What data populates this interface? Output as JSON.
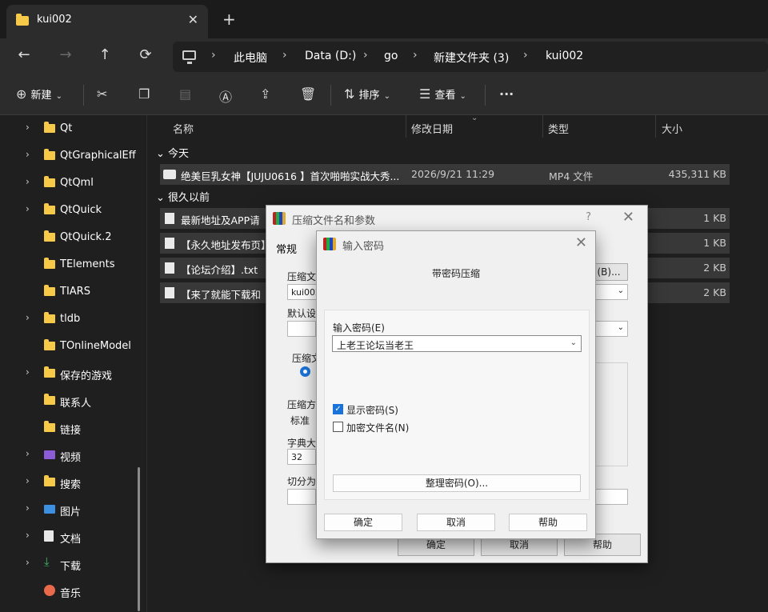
{
  "tab": {
    "title": "kui002",
    "close": "✕",
    "new": "+"
  },
  "nav": {
    "back": "←",
    "forward": "→",
    "up": "↑",
    "refresh": "⟳",
    "sep": "›"
  },
  "breadcrumb": [
    "此电脑",
    "Data (D:)",
    "go",
    "新建文件夹 (3)",
    "kui002"
  ],
  "toolbar": {
    "new_label": "新建",
    "sort_label": "排序",
    "view_label": "查看",
    "more": "···",
    "icons": [
      "cut-icon",
      "copy-icon",
      "paste-icon",
      "rename-icon",
      "share-icon",
      "delete-icon"
    ]
  },
  "sidebar": {
    "items": [
      {
        "label": "Qt",
        "chev": "›",
        "icon": "folder"
      },
      {
        "label": "QtGraphicalEff",
        "chev": "›",
        "icon": "folder"
      },
      {
        "label": "QtQml",
        "chev": "›",
        "icon": "folder"
      },
      {
        "label": "QtQuick",
        "chev": "›",
        "icon": "folder"
      },
      {
        "label": "QtQuick.2",
        "chev": "",
        "icon": "folder"
      },
      {
        "label": "TElements",
        "chev": "",
        "icon": "folder"
      },
      {
        "label": "TIARS",
        "chev": "",
        "icon": "folder"
      },
      {
        "label": "tldb",
        "chev": "›",
        "icon": "folder"
      },
      {
        "label": "TOnlineModel",
        "chev": "",
        "icon": "folder"
      },
      {
        "label": "保存的游戏",
        "chev": "›",
        "icon": "folder"
      },
      {
        "label": "联系人",
        "chev": "",
        "icon": "folder"
      },
      {
        "label": "链接",
        "chev": "",
        "icon": "folder"
      },
      {
        "label": "视频",
        "chev": "›",
        "icon": "video"
      },
      {
        "label": "搜索",
        "chev": "›",
        "icon": "folder"
      },
      {
        "label": "图片",
        "chev": "›",
        "icon": "pic"
      },
      {
        "label": "文档",
        "chev": "›",
        "icon": "doc"
      },
      {
        "label": "下载",
        "chev": "›",
        "icon": "down"
      },
      {
        "label": "音乐",
        "chev": "",
        "icon": "music"
      }
    ]
  },
  "columns": {
    "name": "名称",
    "modified": "修改日期",
    "type": "类型",
    "size": "大小"
  },
  "groups": {
    "today": "今天",
    "long_ago": "很久以前"
  },
  "files_today": [
    {
      "name": "绝美巨乳女神【JUJU0616 】首次啪啪实战大秀...",
      "modified": "2026/9/21 11:29",
      "type": "MP4 文件",
      "size": "435,311 KB"
    }
  ],
  "files_old": [
    {
      "name": "最新地址及APP请",
      "size": "1 KB"
    },
    {
      "name": "【永久地址发布页】",
      "size": "1 KB"
    },
    {
      "name": "【论坛介绍】.txt",
      "size": "2 KB"
    },
    {
      "name": "【来了就能下载和",
      "size": "2 KB"
    }
  ],
  "dialog1": {
    "title": "压缩文件名和参数",
    "help_q": "?",
    "close": "✕",
    "tab_general": "常规",
    "archive_label": "压缩文",
    "archive_value": "kui002",
    "browse": "(B)...",
    "default_label": "默认设",
    "format_label": "压缩文",
    "method_label": "压缩方式",
    "method_value": "标准",
    "dict_label": "字典大小",
    "dict_value": "32",
    "split_label": "切分为分",
    "ok": "确定",
    "cancel": "取消",
    "help": "帮助"
  },
  "dialog2": {
    "title": "输入密码",
    "close": "✕",
    "subtitle": "带密码压缩",
    "pwd_label": "输入密码(E)",
    "pwd_value": "上老王论坛当老王",
    "show_pwd": "显示密码(S)",
    "show_pwd_checked": true,
    "encrypt_names": "加密文件名(N)",
    "encrypt_names_checked": false,
    "organize": "整理密码(O)...",
    "ok": "确定",
    "cancel": "取消",
    "help": "帮助"
  }
}
